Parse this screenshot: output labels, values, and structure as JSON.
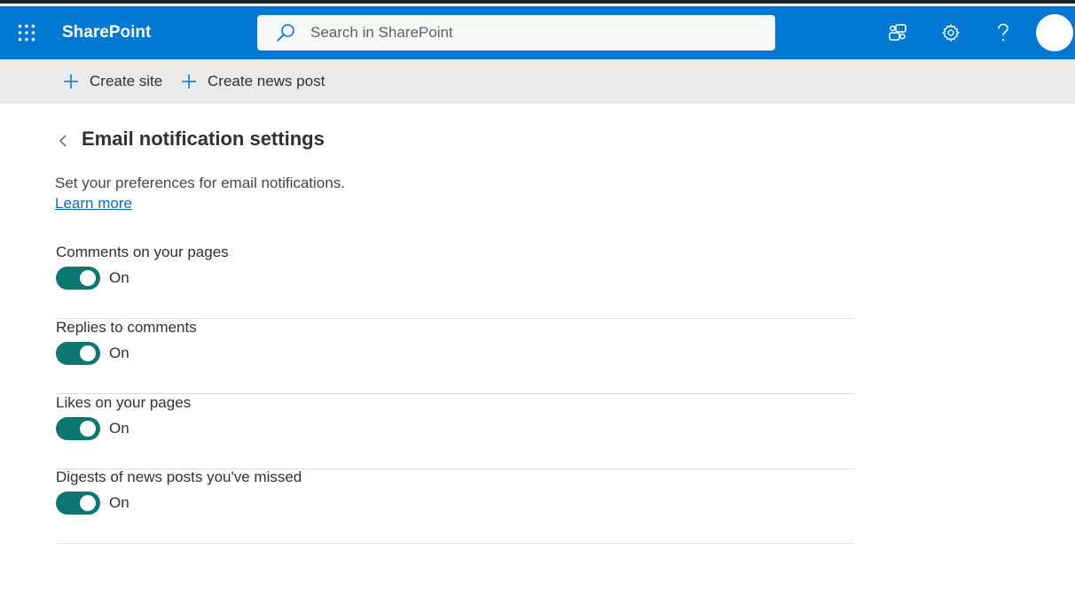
{
  "header": {
    "app_name": "SharePoint",
    "search_placeholder": "Search in SharePoint",
    "icons": [
      "app-launcher-icon",
      "search-icon",
      "chat-feedback-icon",
      "gear-icon",
      "help-icon",
      "avatar"
    ],
    "brand_color": "#0078d4"
  },
  "commandbar": {
    "create_site": "Create site",
    "create_news_post": "Create news post"
  },
  "page": {
    "title": "Email notification settings",
    "description": "Set your preferences for email notifications.",
    "learn_more": "Learn more"
  },
  "settings": [
    {
      "label": "Comments on your pages",
      "state": "On",
      "enabled": true
    },
    {
      "label": "Replies to comments",
      "state": "On",
      "enabled": true
    },
    {
      "label": "Likes on your pages",
      "state": "On",
      "enabled": true
    },
    {
      "label": "Digests of news posts you've missed",
      "state": "On",
      "enabled": true
    }
  ],
  "colors": {
    "toggle_on": "#0c7770",
    "link": "#0f6cbd",
    "commandbar_bg": "#eaeaea"
  }
}
